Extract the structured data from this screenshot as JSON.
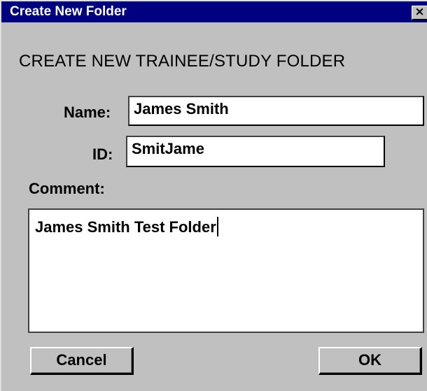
{
  "window": {
    "title": "Create New Folder",
    "close_glyph": "×"
  },
  "heading": "CREATE NEW TRAINEE/STUDY FOLDER",
  "form": {
    "name_label": "Name:",
    "name_value": "James Smith",
    "id_label": "ID:",
    "id_value": "SmitJame",
    "comment_label": "Comment:",
    "comment_value": "James Smith Test Folder"
  },
  "buttons": {
    "cancel_label": "Cancel",
    "ok_label": "OK"
  },
  "colors": {
    "titlebar": "#000080",
    "dialog_face": "#c0c0c0",
    "field_background": "#ffffff"
  }
}
